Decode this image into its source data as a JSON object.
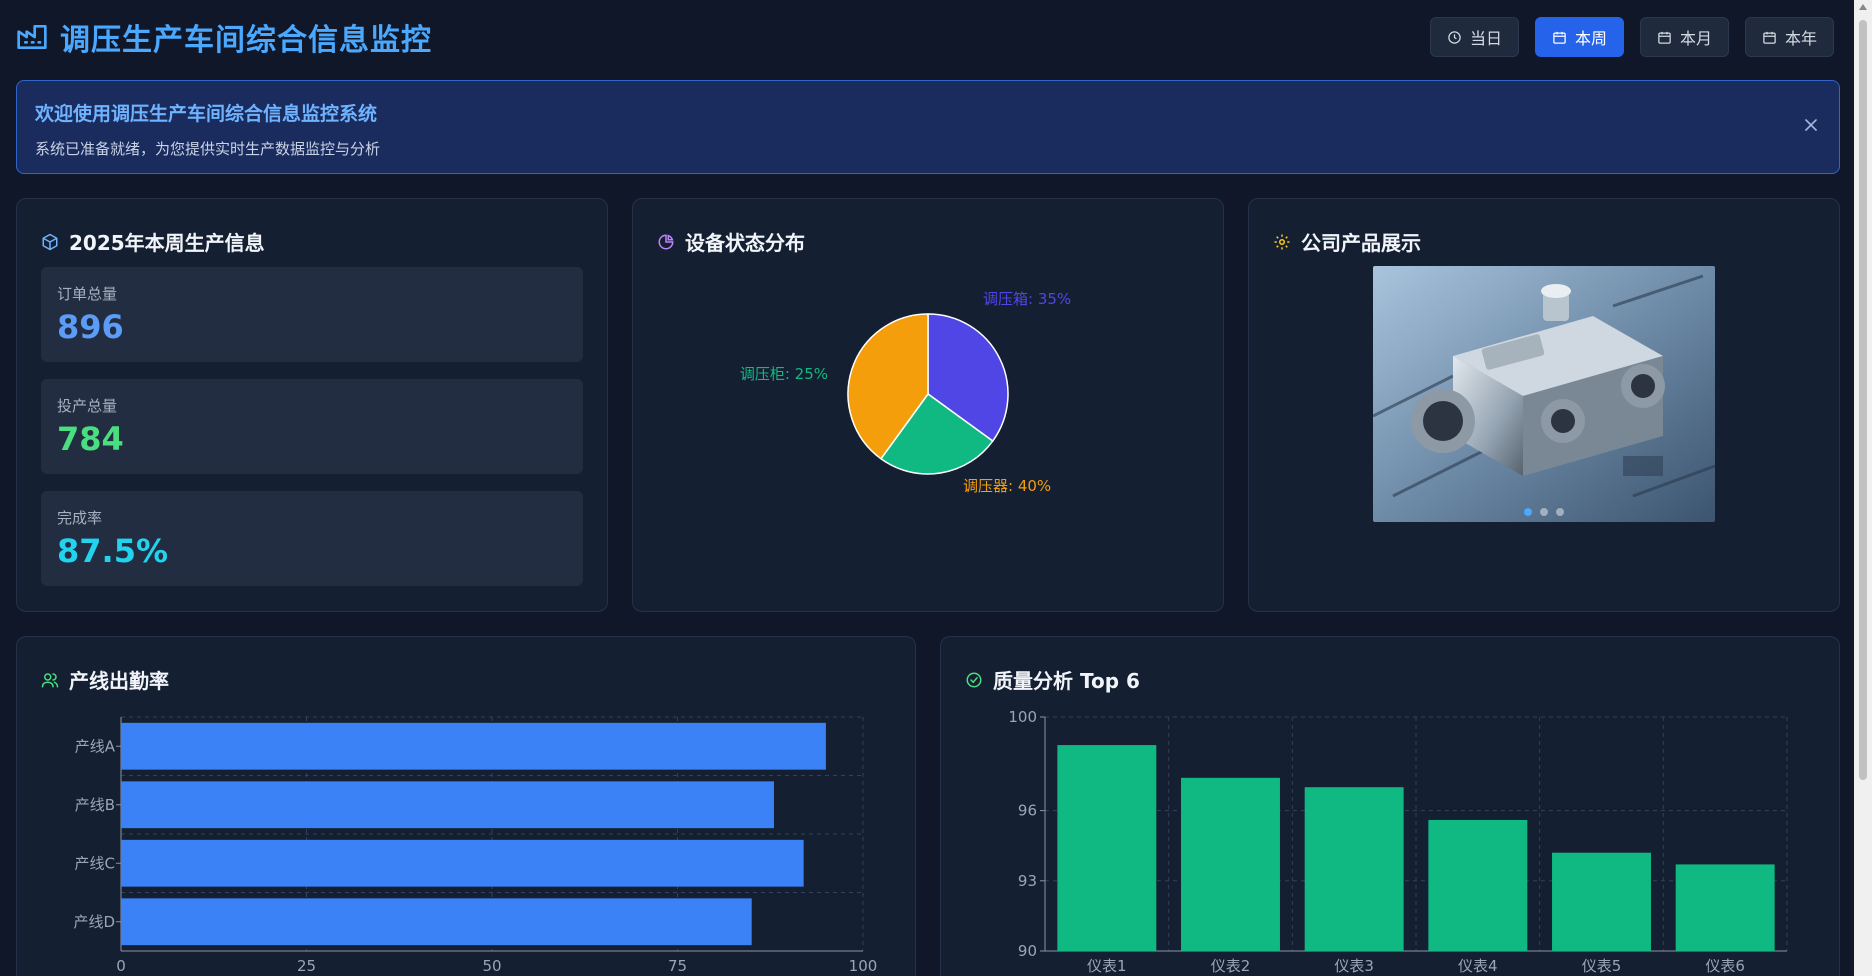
{
  "header": {
    "title": "调压生产车间综合信息监控",
    "ranges": [
      {
        "label": "当日",
        "active": false,
        "icon": "clock-icon"
      },
      {
        "label": "本周",
        "active": true,
        "icon": "calendar-icon"
      },
      {
        "label": "本月",
        "active": false,
        "icon": "calendar-icon"
      },
      {
        "label": "本年",
        "active": false,
        "icon": "calendar-icon"
      }
    ]
  },
  "banner": {
    "title": "欢迎使用调压生产车间综合信息监控系统",
    "subtitle": "系统已准备就绪，为您提供实时生产数据监控与分析"
  },
  "production": {
    "title": "2025年本周生产信息",
    "stats": [
      {
        "label": "订单总量",
        "value": "896",
        "color": "#5b9cf6"
      },
      {
        "label": "投产总量",
        "value": "784",
        "color": "#4ade80"
      },
      {
        "label": "完成率",
        "value": "87.5%",
        "color": "#22d3ee"
      }
    ]
  },
  "equipment": {
    "title": "设备状态分布"
  },
  "products": {
    "title": "公司产品展示",
    "slides": 3,
    "active_slide": 0
  },
  "attendance": {
    "title": "产线出勤率"
  },
  "quality": {
    "title": "质量分析 Top 6"
  },
  "chart_data": [
    {
      "type": "pie",
      "categories": [
        "调压箱",
        "调压柜",
        "调压器"
      ],
      "values": [
        35,
        25,
        40
      ],
      "labels": [
        "调压箱: 35%",
        "调压柜: 25%",
        "调压器: 40%"
      ],
      "colors": [
        "#5046e5",
        "#10b981",
        "#f59e0b"
      ]
    },
    {
      "type": "bar",
      "orientation": "horizontal",
      "categories": [
        "产线A",
        "产线B",
        "产线C",
        "产线D"
      ],
      "values": [
        95,
        88,
        92,
        85
      ],
      "xlim": [
        0,
        100
      ],
      "ticks": [
        "0",
        "25",
        "50",
        "75",
        "100"
      ],
      "grid": true,
      "color": "#3b82f6"
    },
    {
      "type": "bar",
      "categories": [
        "仪表1",
        "仪表2",
        "仪表3",
        "仪表4",
        "仪表5",
        "仪表6"
      ],
      "values": [
        98.8,
        97.4,
        97.0,
        95.6,
        94.2,
        93.7
      ],
      "ylim": [
        90,
        100
      ],
      "ticks": [
        "90",
        "93",
        "96",
        "100"
      ],
      "grid": true,
      "color": "#10b981"
    }
  ]
}
